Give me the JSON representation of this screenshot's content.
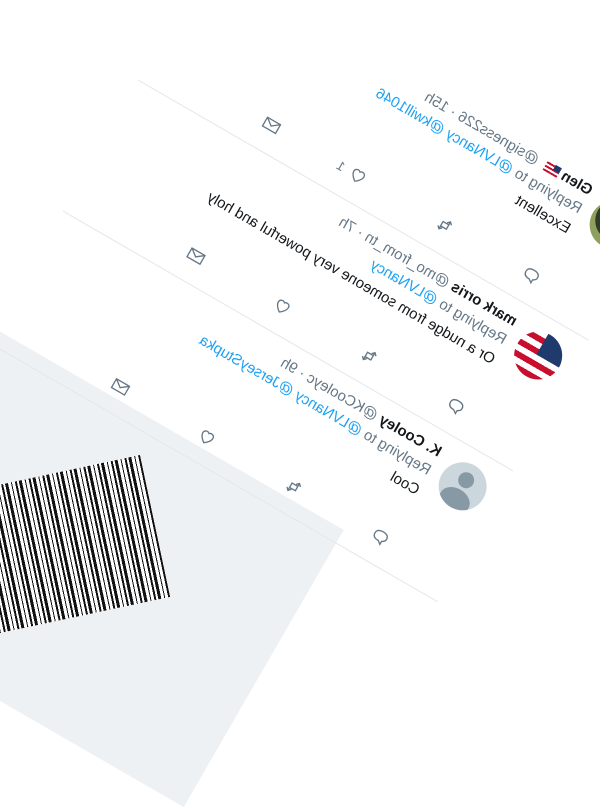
{
  "tweets": [
    {
      "name": "Glen",
      "handle": "@signess226",
      "time": "15h",
      "replying_prefix": "Replying to",
      "mentions": "@LVNancy @kwill1046",
      "text": "Excellent",
      "reply_count": "",
      "retweet_count": "",
      "like_count": "1"
    },
    {
      "name": "mark orris",
      "handle": "@mo_from_tn",
      "time": "7h",
      "replying_prefix": "Replying to",
      "mentions": "@LVNancy",
      "text": "Or a nudge from someone very powerful and holy",
      "reply_count": "",
      "retweet_count": "",
      "like_count": ""
    },
    {
      "name": "K. Cooley",
      "handle": "@KCooleyc",
      "time": "9h",
      "replying_prefix": "Replying to",
      "mentions": "@LVNancy @JerseyStupka",
      "text": "Cool",
      "reply_count": "",
      "retweet_count": "",
      "like_count": ""
    }
  ],
  "icons": {
    "reply": "reply-icon",
    "retweet": "retweet-icon",
    "like": "heart-icon",
    "dm": "envelope-icon"
  },
  "colors": {
    "link": "#1da1f2",
    "muted": "#657786",
    "text": "#14171a"
  }
}
